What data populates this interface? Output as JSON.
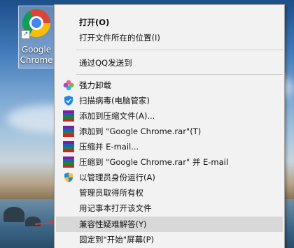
{
  "desktop": {
    "icon_label": "Google Chrome"
  },
  "menu": {
    "items": [
      {
        "label": "打开(O)",
        "icon": "none"
      },
      {
        "label": "打开文件所在的位置(I)",
        "icon": "none"
      },
      {
        "label": "通过QQ发送到",
        "icon": "none"
      },
      {
        "label": "强力卸载",
        "icon": "clover-icon"
      },
      {
        "label": "扫描病毒(电脑管家)",
        "icon": "shield-icon"
      },
      {
        "label": "添加到压缩文件(A)...",
        "icon": "winrar-icon"
      },
      {
        "label": "添加到 \"Google Chrome.rar\"(T)",
        "icon": "winrar-icon"
      },
      {
        "label": "压缩并 E-mail...",
        "icon": "winrar-icon"
      },
      {
        "label": "压缩到 \"Google Chrome.rar\" 并 E-mail",
        "icon": "winrar-icon"
      },
      {
        "label": "以管理员身份运行(A)",
        "icon": "uac-shield-icon"
      },
      {
        "label": "管理员取得所有权",
        "icon": "none"
      },
      {
        "label": "用记事本打开该文件",
        "icon": "none"
      },
      {
        "label": "兼容性疑难解答(Y)",
        "icon": "none"
      },
      {
        "label": "固定到\"开始\"屏幕(P)",
        "icon": "none"
      }
    ]
  },
  "colors": {
    "menu_bg": "#f2f2f2",
    "highlight": "#d8d8d8",
    "annotation_arrow": "#e53935"
  }
}
